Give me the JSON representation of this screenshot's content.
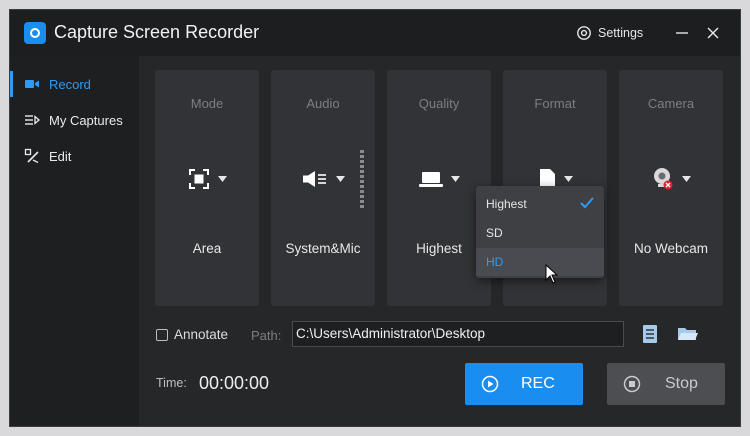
{
  "app": {
    "title": "Capture Screen Recorder",
    "settings_label": "Settings",
    "logo_icon": "camera-record-logo-icon"
  },
  "sidebar": {
    "items": [
      {
        "label": "Record",
        "icon": "video-camera-icon",
        "active": true
      },
      {
        "label": "My Captures",
        "icon": "list-play-icon",
        "active": false
      },
      {
        "label": "Edit",
        "icon": "edit-tools-icon",
        "active": false
      }
    ]
  },
  "options": [
    {
      "title": "Mode",
      "value": "Area",
      "icon": "area-select-icon"
    },
    {
      "title": "Audio",
      "value": "System&Mic",
      "icon": "speaker-icon"
    },
    {
      "title": "Quality",
      "value": "Highest",
      "icon": "laptop-icon"
    },
    {
      "title": "Format",
      "value": "",
      "icon": "file-icon"
    },
    {
      "title": "Camera",
      "value": "No Webcam",
      "icon": "webcam-off-icon"
    }
  ],
  "quality_dropdown": {
    "options": [
      "Highest",
      "SD",
      "HD"
    ],
    "selected": "Highest",
    "hovered": "HD"
  },
  "annotate_label": "Annotate",
  "annotate_checked": false,
  "path": {
    "label": "Path:",
    "value": "C:\\Users\\Administrator\\Desktop"
  },
  "time": {
    "label": "Time:",
    "value": "00:00:00"
  },
  "rec_label": "REC",
  "stop_label": "Stop",
  "colors": {
    "accent": "#1a8ef0",
    "hover_text": "#2d9bf5",
    "background": "#262729",
    "card": "#323336"
  }
}
